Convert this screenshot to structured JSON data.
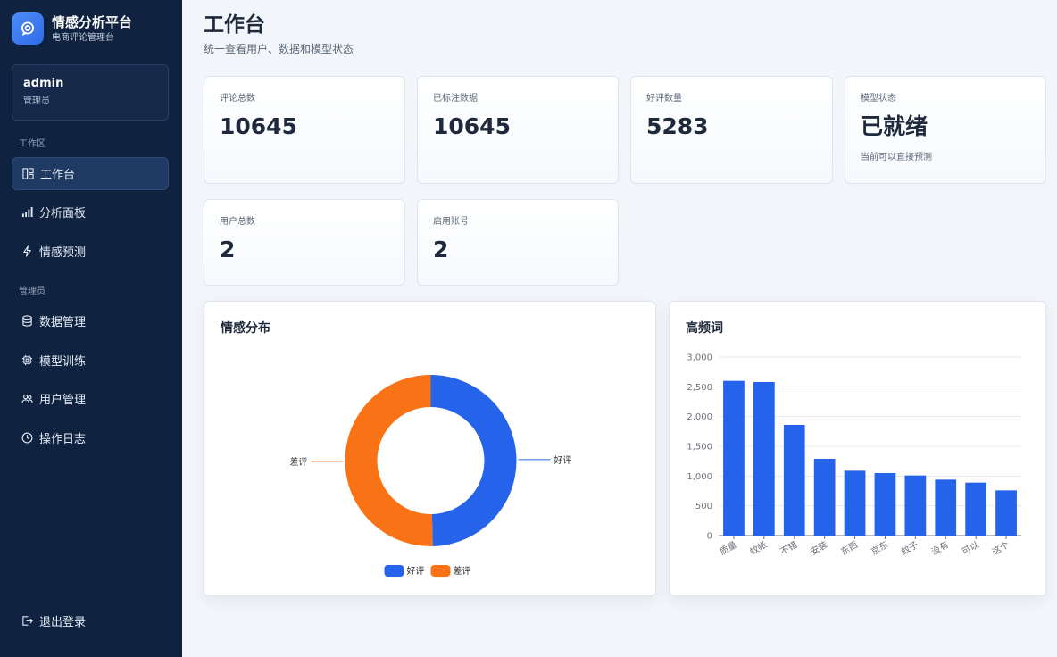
{
  "brand": {
    "title": "情感分析平台",
    "subtitle": "电商评论管理台"
  },
  "user": {
    "name": "admin",
    "role": "管理员"
  },
  "nav": {
    "section_work": "工作区",
    "section_admin": "管理员",
    "items": [
      {
        "label": "工作台",
        "icon": "dashboard-icon",
        "active": true
      },
      {
        "label": "分析面板",
        "icon": "bar-chart-icon"
      },
      {
        "label": "情感预测",
        "icon": "lightning-icon"
      },
      {
        "label": "数据管理",
        "icon": "database-icon"
      },
      {
        "label": "模型训练",
        "icon": "chip-icon"
      },
      {
        "label": "用户管理",
        "icon": "users-icon"
      },
      {
        "label": "操作日志",
        "icon": "clock-icon"
      }
    ],
    "logout": "退出登录"
  },
  "header": {
    "title": "工作台",
    "subtitle": "统一查看用户、数据和模型状态"
  },
  "stats": [
    {
      "label": "评论总数",
      "value": "10645"
    },
    {
      "label": "已标注数据",
      "value": "10645"
    },
    {
      "label": "好评数量",
      "value": "5283"
    },
    {
      "label": "模型状态",
      "value": "已就绪",
      "note": "当前可以直接预测"
    },
    {
      "label": "用户总数",
      "value": "2"
    },
    {
      "label": "启用账号",
      "value": "2"
    }
  ],
  "chart_data": [
    {
      "type": "pie",
      "title": "情感分布",
      "categories": [
        "好评",
        "差评"
      ],
      "values": [
        5283,
        5362
      ],
      "colors": [
        "#2563eb",
        "#f97316"
      ],
      "legend": "bottom-center"
    },
    {
      "type": "bar",
      "title": "高频词",
      "categories": [
        "质量",
        "蚊帐",
        "不错",
        "安装",
        "东西",
        "京东",
        "蚊子",
        "没有",
        "可以",
        "这个"
      ],
      "values": [
        2600,
        2580,
        1860,
        1290,
        1090,
        1050,
        1010,
        940,
        890,
        760
      ],
      "ylim": [
        0,
        3000
      ],
      "yticks": [
        "0",
        "500",
        "1,000",
        "1,500",
        "2,000",
        "2,500",
        "3,000"
      ],
      "color": "#2563eb",
      "grid": true
    }
  ]
}
